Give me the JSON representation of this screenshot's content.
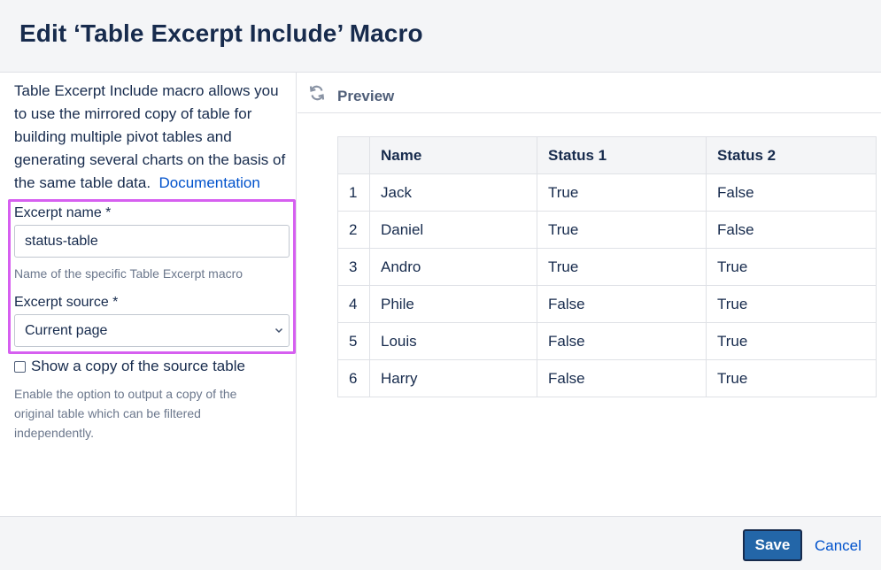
{
  "dialog": {
    "title": "Edit ‘Table Excerpt Include’ Macro"
  },
  "form": {
    "description": "Table Excerpt Include macro allows you to use the mirrored copy of table for building multiple pivot tables and generating several charts on the basis of the same table data.",
    "documentation_link": "Documentation",
    "excerpt_name": {
      "label": "Excerpt name *",
      "value": "status-table",
      "hint": "Name of the specific Table Excerpt macro"
    },
    "excerpt_source": {
      "label": "Excerpt source *",
      "selected": "Current page",
      "chevron_icon": "chevron-down-icon"
    },
    "show_copy": {
      "label": "Show a copy of the source table",
      "checked": false,
      "hint": "Enable the option to output a copy of the original table which can be filtered independently."
    },
    "highlight_color": "#d65ff0"
  },
  "preview": {
    "title": "Preview",
    "icon": "refresh-icon",
    "table": {
      "headers": [
        "",
        "Name",
        "Status 1",
        "Status 2"
      ],
      "rows": [
        [
          "1",
          "Jack",
          "True",
          "False"
        ],
        [
          "2",
          "Daniel",
          "True",
          "False"
        ],
        [
          "3",
          "Andro",
          "True",
          "True"
        ],
        [
          "4",
          "Phile",
          "False",
          "True"
        ],
        [
          "5",
          "Louis",
          "False",
          "True"
        ],
        [
          "6",
          "Harry",
          "False",
          "True"
        ]
      ]
    }
  },
  "footer": {
    "save_label": "Save",
    "cancel_label": "Cancel",
    "save_color": "#2366a8"
  }
}
